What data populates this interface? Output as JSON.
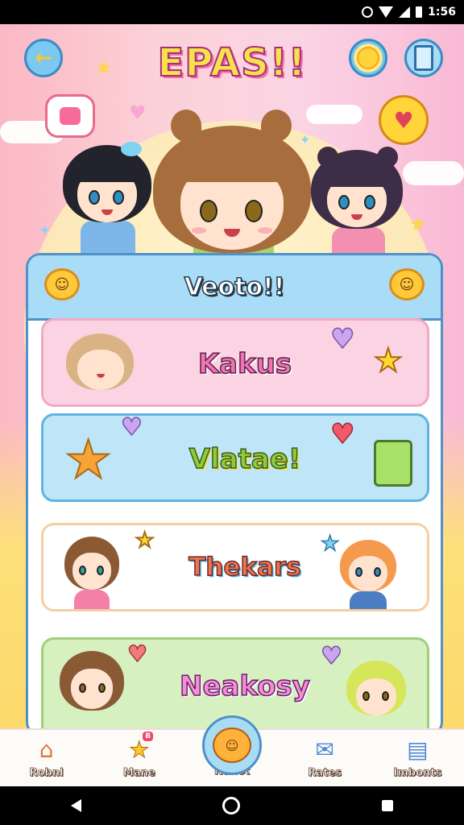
{
  "status_bar": {
    "time": "1:56"
  },
  "header": {
    "title": "EPAS!!",
    "back_glyph": "←"
  },
  "card": {
    "title": "Veoto!!"
  },
  "menu": [
    {
      "label": "Kakus"
    },
    {
      "label": "Vlatae!"
    },
    {
      "label": "Thekars"
    },
    {
      "label": "Neakosy"
    }
  ],
  "bottom_nav": [
    {
      "label": "Robnl",
      "icon": "home-icon"
    },
    {
      "label": "Mane",
      "icon": "star-icon",
      "badge": "B"
    },
    {
      "label": "Nanot",
      "icon": "smiley-icon"
    },
    {
      "label": "Rates",
      "icon": "heart-folder-icon"
    },
    {
      "label": "Imbonts",
      "icon": "list-card-icon"
    }
  ],
  "colors": {
    "accent_blue": "#4f91c8",
    "pink": "#f174b4",
    "yellow": "#ffd832"
  }
}
